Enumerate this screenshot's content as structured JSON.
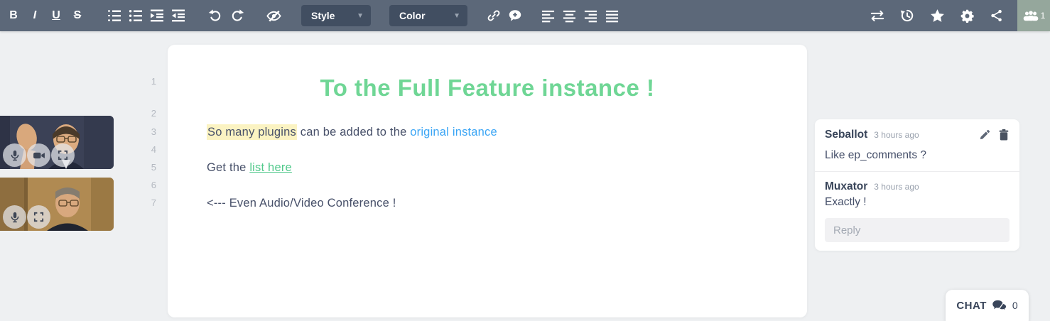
{
  "toolbar": {
    "bold": "B",
    "italic": "I",
    "underline": "U",
    "strikethrough": "S",
    "style_dropdown": {
      "value": "Style"
    },
    "color_dropdown": {
      "value": "Color"
    },
    "users_count": "1",
    "icon_names": [
      "bold",
      "italic",
      "underline",
      "strikethrough",
      "ordered-list",
      "unordered-list",
      "indent",
      "outdent",
      "undo",
      "redo",
      "hide-authorship",
      "link",
      "add-comment",
      "align-left",
      "align-center",
      "align-right",
      "align-justify",
      "import-export",
      "history",
      "star",
      "settings-gear",
      "share",
      "users"
    ]
  },
  "video_panel": {
    "participants": [
      {
        "controls": [
          "microphone",
          "camera",
          "fullscreen"
        ]
      },
      {
        "controls": [
          "microphone",
          "fullscreen"
        ]
      }
    ]
  },
  "pad": {
    "line_numbers": [
      "1",
      "2",
      "3",
      "4",
      "5",
      "6",
      "7"
    ],
    "heading": "To the Full Feature instance !",
    "paragraph1": {
      "highlight": "So many plugins",
      "text": " can be added to the ",
      "link": "original instance"
    },
    "paragraph2": {
      "text": "Get the ",
      "link": "list here"
    },
    "paragraph3": "<--- Even Audio/Video Conference !"
  },
  "comments": {
    "items": [
      {
        "author": "Seballot",
        "time": "3 hours ago",
        "text": "Like ep_comments ?"
      },
      {
        "author": "Muxator",
        "time": "3 hours ago",
        "text": "Exactly !"
      }
    ],
    "reply_placeholder": "Reply"
  },
  "chat": {
    "label": "CHAT",
    "count": "0"
  },
  "colors": {
    "toolbar_bg": "#5c6879",
    "dropdown_bg": "#414e61",
    "users_button_bg": "#95a79c",
    "page_bg": "#eef0f2",
    "heading_green": "#6fd695",
    "link_blue": "#3aa5f5",
    "link_green": "#51c98b",
    "highlight_yellow": "#fbf3c2",
    "body_text": "#475069",
    "muted_text": "#9aa2ae"
  }
}
